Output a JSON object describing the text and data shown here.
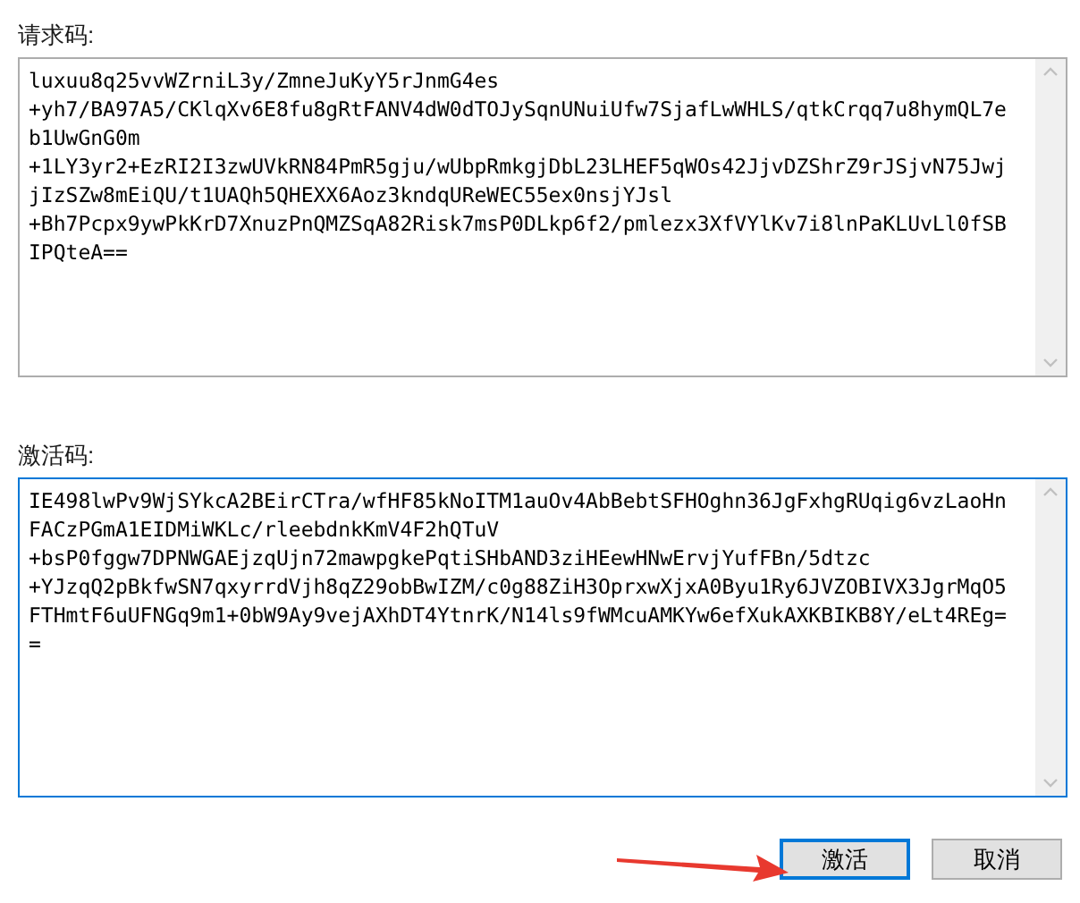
{
  "request_code": {
    "label": "请求码:",
    "lines": [
      "luxuu8q25vvWZrniL3y/ZmneJuKyY5rJnmG4es",
      "+yh7/BA97A5/CKlqXv6E8fu8gRtFANV4dW0dTOJySqnUNuiUfw7SjafLwWHLS/qtkCrqq7u8hymQL7e",
      "b1UwGnG0m",
      "+1LY3yr2+EzRI2I3zwUVkRN84PmR5gju/wUbpRmkgjDbL23LHEF5qWOs42JjvDZShrZ9rJSjvN75Jwj",
      "jIzSZw8mEiQU/t1UAQh5QHEXX6Aoz3kndqUReWEC55ex0nsjYJsl",
      "+Bh7Pcpx9ywPkKrD7XnuzPnQMZSqA82Risk7msP0DLkp6f2/pmlezx3XfVYlKv7i8lnPaKLUvLl0fSB",
      "IPQteA=="
    ],
    "focused": false
  },
  "activation_code": {
    "label": "激活码:",
    "lines": [
      "IE498lwPv9WjSYkcA2BEirCTra/wfHF85kNoITM1auOv4AbBebtSFHOghn36JgFxhgRUqig6vzLaoHn",
      "FACzPGmA1EIDMiWKLc/rleebdnkKmV4F2hQTuV",
      "+bsP0fggw7DPNWGAEjzqUjn72mawpgkePqtiSHbAND3ziHEewHNwErvjYufFBn/5dtzc",
      "+YJzqQ2pBkfwSN7qxyrrdVjh8qZ29obBwIZM/c0g88ZiH3OprxwXjxA0Byu1Ry6JVZOBIVX3JgrMqO5",
      "FTHmtF6uUFNGq9m1+0bW9Ay9vejAXhDT4YtnrK/N14ls9fWMcuAMKYw6efXukAXKBIKB8Y/eLt4REg=",
      "="
    ],
    "focused": true
  },
  "buttons": [
    {
      "label": "激活",
      "selected": true
    },
    {
      "label": "取消",
      "selected": false
    }
  ]
}
